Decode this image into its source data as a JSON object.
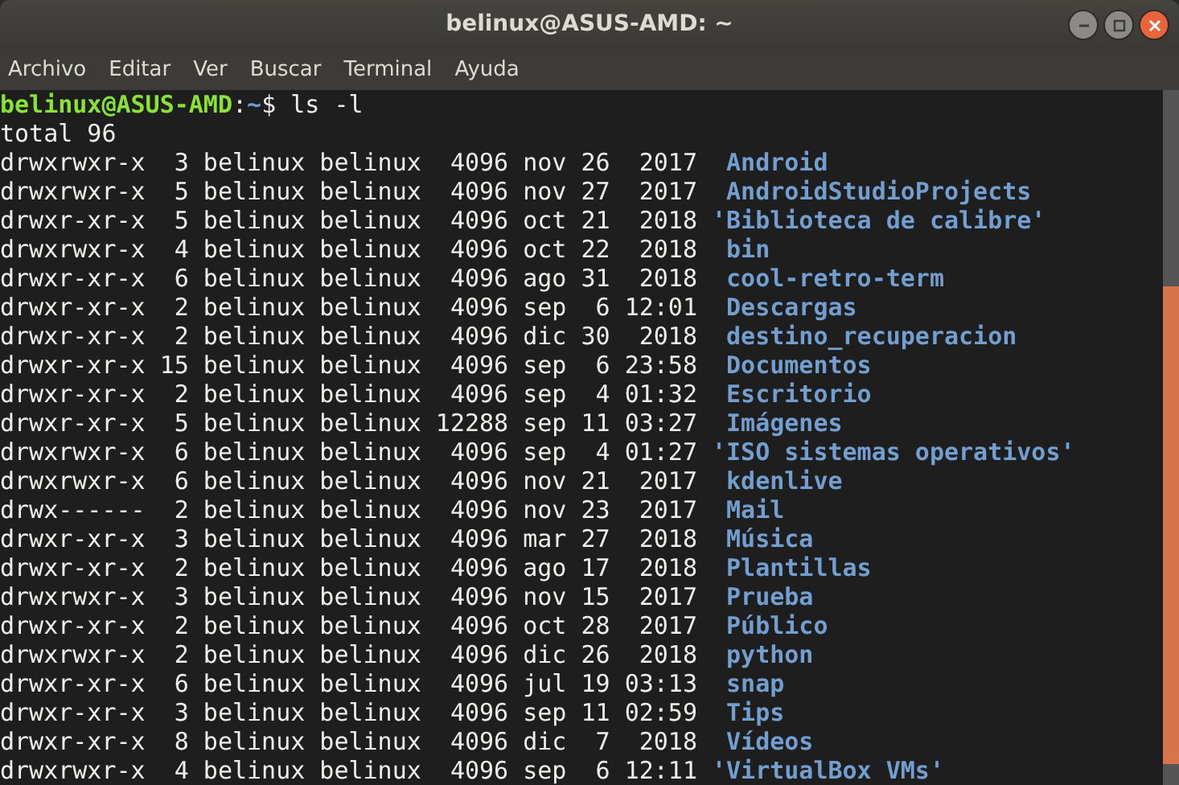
{
  "window": {
    "title": "belinux@ASUS-AMD: ~"
  },
  "menu": [
    "Archivo",
    "Editar",
    "Ver",
    "Buscar",
    "Terminal",
    "Ayuda"
  ],
  "prompt": {
    "user_host": "belinux@ASUS-AMD",
    "separator": ":",
    "path": "~",
    "symbol": "$",
    "command": "ls -l"
  },
  "total": "total 96",
  "rows": [
    {
      "details": "drwxrwxr-x  3 belinux belinux  4096 nov 26  2017",
      "name": "Android",
      "quoted": false
    },
    {
      "details": "drwxrwxr-x  5 belinux belinux  4096 nov 27  2017",
      "name": "AndroidStudioProjects",
      "quoted": false
    },
    {
      "details": "drwxr-xr-x  5 belinux belinux  4096 oct 21  2018",
      "name": "'Biblioteca de calibre'",
      "quoted": true
    },
    {
      "details": "drwxrwxr-x  4 belinux belinux  4096 oct 22  2018",
      "name": "bin",
      "quoted": false
    },
    {
      "details": "drwxr-xr-x  6 belinux belinux  4096 ago 31  2018",
      "name": "cool-retro-term",
      "quoted": false
    },
    {
      "details": "drwxr-xr-x  2 belinux belinux  4096 sep  6 12:01",
      "name": "Descargas",
      "quoted": false
    },
    {
      "details": "drwxr-xr-x  2 belinux belinux  4096 dic 30  2018",
      "name": "destino_recuperacion",
      "quoted": false
    },
    {
      "details": "drwxr-xr-x 15 belinux belinux  4096 sep  6 23:58",
      "name": "Documentos",
      "quoted": false
    },
    {
      "details": "drwxr-xr-x  2 belinux belinux  4096 sep  4 01:32",
      "name": "Escritorio",
      "quoted": false
    },
    {
      "details": "drwxr-xr-x  5 belinux belinux 12288 sep 11 03:27",
      "name": "Imágenes",
      "quoted": false
    },
    {
      "details": "drwxrwxr-x  6 belinux belinux  4096 sep  4 01:27",
      "name": "'ISO sistemas operativos'",
      "quoted": true
    },
    {
      "details": "drwxrwxr-x  6 belinux belinux  4096 nov 21  2017",
      "name": "kdenlive",
      "quoted": false
    },
    {
      "details": "drwx------  2 belinux belinux  4096 nov 23  2017",
      "name": "Mail",
      "quoted": false
    },
    {
      "details": "drwxr-xr-x  3 belinux belinux  4096 mar 27  2018",
      "name": "Música",
      "quoted": false
    },
    {
      "details": "drwxr-xr-x  2 belinux belinux  4096 ago 17  2018",
      "name": "Plantillas",
      "quoted": false
    },
    {
      "details": "drwxrwxr-x  3 belinux belinux  4096 nov 15  2017",
      "name": "Prueba",
      "quoted": false
    },
    {
      "details": "drwxr-xr-x  2 belinux belinux  4096 oct 28  2017",
      "name": "Público",
      "quoted": false
    },
    {
      "details": "drwxrwxr-x  2 belinux belinux  4096 dic 26  2018",
      "name": "python",
      "quoted": false
    },
    {
      "details": "drwxr-xr-x  6 belinux belinux  4096 jul 19 03:13",
      "name": "snap",
      "quoted": false
    },
    {
      "details": "drwxr-xr-x  3 belinux belinux  4096 sep 11 02:59",
      "name": "Tips",
      "quoted": false
    },
    {
      "details": "drwxr-xr-x  8 belinux belinux  4096 dic  7  2018",
      "name": "Vídeos",
      "quoted": false
    },
    {
      "details": "drwxrwxr-x  4 belinux belinux  4096 sep  6 12:11",
      "name": "'VirtualBox VMs'",
      "quoted": true
    }
  ]
}
